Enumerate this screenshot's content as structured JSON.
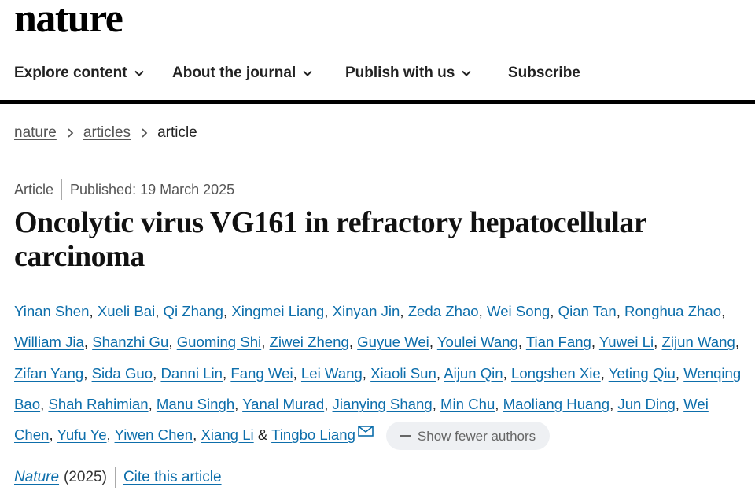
{
  "header": {
    "logo": "nature"
  },
  "nav": {
    "items": [
      {
        "label": "Explore content",
        "has_dropdown": true
      },
      {
        "label": "About the journal",
        "has_dropdown": true
      },
      {
        "label": "Publish with us",
        "has_dropdown": true
      }
    ],
    "subscribe": "Subscribe"
  },
  "breadcrumb": {
    "items": [
      "nature",
      "articles"
    ],
    "current": "article"
  },
  "article": {
    "type": "Article",
    "published": "Published: 19 March 2025",
    "title": "Oncolytic virus VG161 in refractory hepatocellular carcinoma",
    "authors": [
      "Yinan Shen",
      "Xueli Bai",
      "Qi Zhang",
      "Xingmei Liang",
      "Xinyan Jin",
      "Zeda Zhao",
      "Wei Song",
      "Qian Tan",
      "Ronghua Zhao",
      "William Jia",
      "Shanzhi Gu",
      "Guoming Shi",
      "Ziwei Zheng",
      "Guyue Wei",
      "Youlei Wang",
      "Tian Fang",
      "Yuwei Li",
      "Zijun Wang",
      "Zifan Yang",
      "Sida Guo",
      "Danni Lin",
      "Fang Wei",
      "Lei Wang",
      "Xiaoli Sun",
      "Aijun Qin",
      "Longshen Xie",
      "Yeting Qiu",
      "Wenqing Bao",
      "Shah Rahimian",
      "Manu Singh",
      "Yanal Murad",
      "Jianying Shang",
      "Min Chu",
      "Maoliang Huang",
      "Jun Ding",
      "Wei Chen",
      "Yufu Ye",
      "Yiwen Chen",
      "Xiang Li"
    ],
    "authors_joiner": "&",
    "last_author": "Tingbo Liang",
    "show_fewer": "Show fewer authors",
    "journal": "Nature",
    "year": "(2025)",
    "cite": "Cite this article"
  },
  "colors": {
    "link": "#0d6eab",
    "nav_rule": "#000000"
  }
}
